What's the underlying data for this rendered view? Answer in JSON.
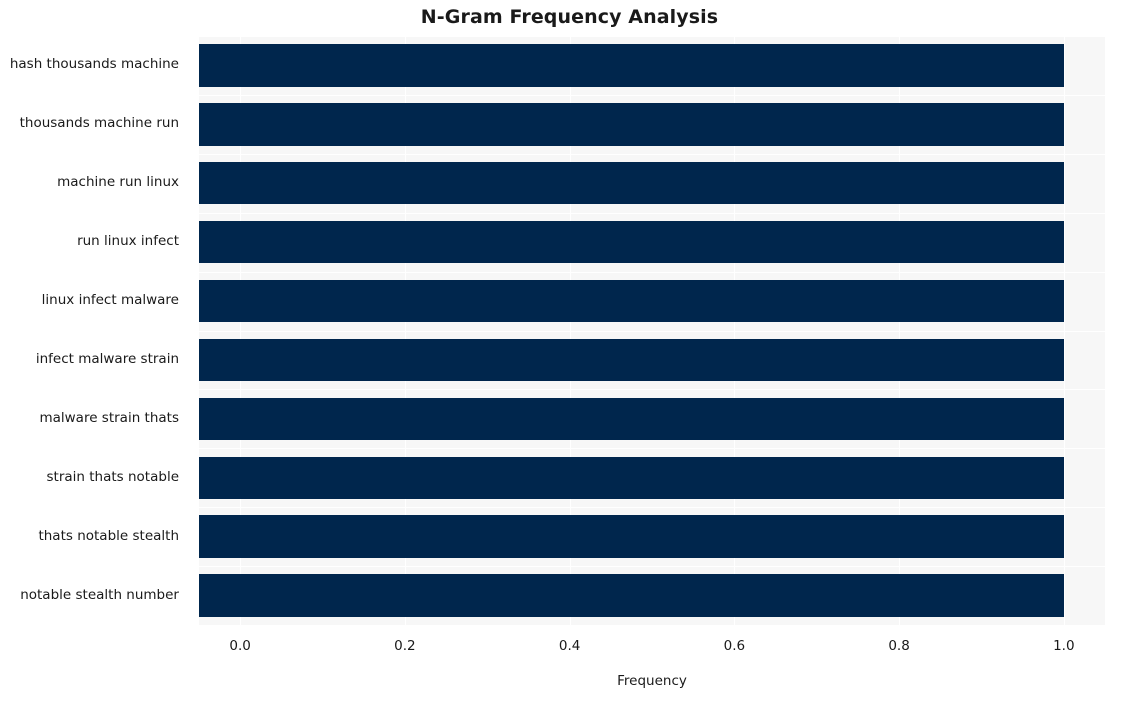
{
  "chart_data": {
    "type": "bar",
    "orientation": "horizontal",
    "title": "N-Gram Frequency Analysis",
    "xlabel": "Frequency",
    "ylabel": "",
    "categories": [
      "hash thousands machine",
      "thousands machine run",
      "machine run linux",
      "run linux infect",
      "linux infect malware",
      "infect malware strain",
      "malware strain thats",
      "strain thats notable",
      "thats notable stealth",
      "notable stealth number"
    ],
    "values": [
      1.0,
      1.0,
      1.0,
      1.0,
      1.0,
      1.0,
      1.0,
      1.0,
      1.0,
      1.0
    ],
    "xlim": [
      -0.05,
      1.05
    ],
    "xticks": [
      "0.0",
      "0.2",
      "0.4",
      "0.6",
      "0.8",
      "1.0"
    ],
    "xtick_values": [
      0.0,
      0.2,
      0.4,
      0.6,
      0.8,
      1.0
    ],
    "grid": true,
    "legend": null,
    "bar_color": "#00264d",
    "plot_background": "#f7f7f7",
    "figure_background": "#ffffff"
  }
}
